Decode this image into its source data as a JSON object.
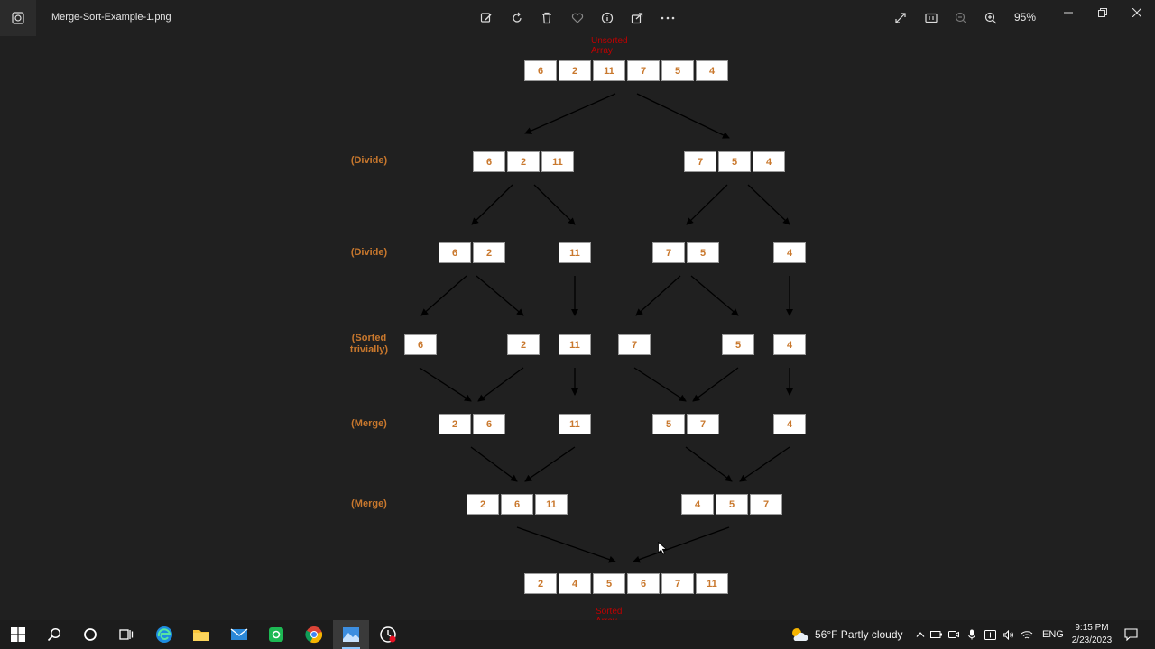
{
  "window": {
    "title": "Merge-Sort-Example-1.png",
    "zoom": "95%"
  },
  "toolbar": {
    "icons": [
      "edit-image-icon",
      "rotate-icon",
      "delete-icon",
      "favorite-icon",
      "info-icon",
      "share-icon",
      "more-icon"
    ],
    "right_icons": [
      "expand-icon",
      "actual-size-icon",
      "zoom-out-icon",
      "zoom-in-icon"
    ]
  },
  "diagram": {
    "top_caption": "Unsorted Array",
    "bottom_caption": "Sorted Array",
    "arrow_color": "#000000",
    "cell_text_color": "#c9782d",
    "caption_color": "#c00000",
    "stages": [
      {
        "label": "(Divide)"
      },
      {
        "label": "(Divide)"
      },
      {
        "label": "(Sorted trivially)"
      },
      {
        "label": "(Merge)"
      },
      {
        "label": "(Merge)"
      }
    ],
    "arrays": {
      "unsorted": [
        "6",
        "2",
        "11",
        "7",
        "5",
        "4"
      ],
      "divide1_left": [
        "6",
        "2",
        "11"
      ],
      "divide1_right": [
        "7",
        "5",
        "4"
      ],
      "divide2_a": [
        "6",
        "2"
      ],
      "divide2_b": [
        "11"
      ],
      "divide2_c": [
        "7",
        "5"
      ],
      "divide2_d": [
        "4"
      ],
      "trivial_1": [
        "6"
      ],
      "trivial_2": [
        "2"
      ],
      "trivial_3": [
        "11"
      ],
      "trivial_4": [
        "7"
      ],
      "trivial_5": [
        "5"
      ],
      "trivial_6": [
        "4"
      ],
      "merge1_a": [
        "2",
        "6"
      ],
      "merge1_b": [
        "11"
      ],
      "merge1_c": [
        "5",
        "7"
      ],
      "merge1_d": [
        "4"
      ],
      "merge2_left": [
        "2",
        "6",
        "11"
      ],
      "merge2_right": [
        "4",
        "5",
        "7"
      ],
      "sorted": [
        "2",
        "4",
        "5",
        "6",
        "7",
        "11"
      ]
    }
  },
  "taskbar": {
    "apps": [
      "windows-start-icon",
      "search-icon",
      "cortana-icon",
      "task-view-icon",
      "edge-icon",
      "file-explorer-icon",
      "mail-icon",
      "green-app-icon",
      "chrome-icon",
      "photos-icon",
      "recorder-icon"
    ],
    "weather": "56°F  Partly cloudy",
    "language": "ENG",
    "time": "9:15 PM",
    "date": "2/23/2023"
  }
}
